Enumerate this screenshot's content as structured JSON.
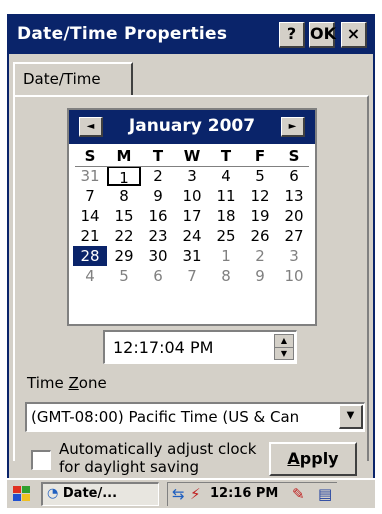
{
  "window": {
    "title": "Date/Time Properties",
    "help_button": "?",
    "ok_button": "OK",
    "close_button": "×"
  },
  "tabs": [
    {
      "label": "Date/Time"
    }
  ],
  "calendar": {
    "month_label": "January 2007",
    "prev_icon": "◄",
    "next_icon": "►",
    "weekdays": [
      "S",
      "M",
      "T",
      "W",
      "T",
      "F",
      "S"
    ],
    "weeks": [
      [
        "31",
        "1",
        "2",
        "3",
        "4",
        "5",
        "6"
      ],
      [
        "7",
        "8",
        "9",
        "10",
        "11",
        "12",
        "13"
      ],
      [
        "14",
        "15",
        "16",
        "17",
        "18",
        "19",
        "20"
      ],
      [
        "21",
        "22",
        "23",
        "24",
        "25",
        "26",
        "27"
      ],
      [
        "28",
        "29",
        "30",
        "31",
        "1",
        "2",
        "3"
      ],
      [
        "4",
        "5",
        "6",
        "7",
        "8",
        "9",
        "10"
      ]
    ],
    "today": "1",
    "selected": "28"
  },
  "time": {
    "value": "12:17:04 PM",
    "spin_up": "▲",
    "spin_down": "▼"
  },
  "timezone": {
    "label_prefix": "Time ",
    "label_accel": "Z",
    "label_suffix": "one",
    "value": "(GMT-08:00) Pacific Time (US & Can",
    "dropdown_icon": "▼"
  },
  "daylight": {
    "label": "Automatically adjust clock for daylight saving",
    "checked": false
  },
  "apply_button": {
    "accel": "A",
    "rest": "pply"
  },
  "taskbar": {
    "start_icon": "windows-flag-icon",
    "task_label": "Date/...",
    "clock": "12:16 PM"
  },
  "colors": {
    "title_bar": "#0a246a",
    "window_bg": "#d4d0c8",
    "selected_day": "#0a246a"
  }
}
